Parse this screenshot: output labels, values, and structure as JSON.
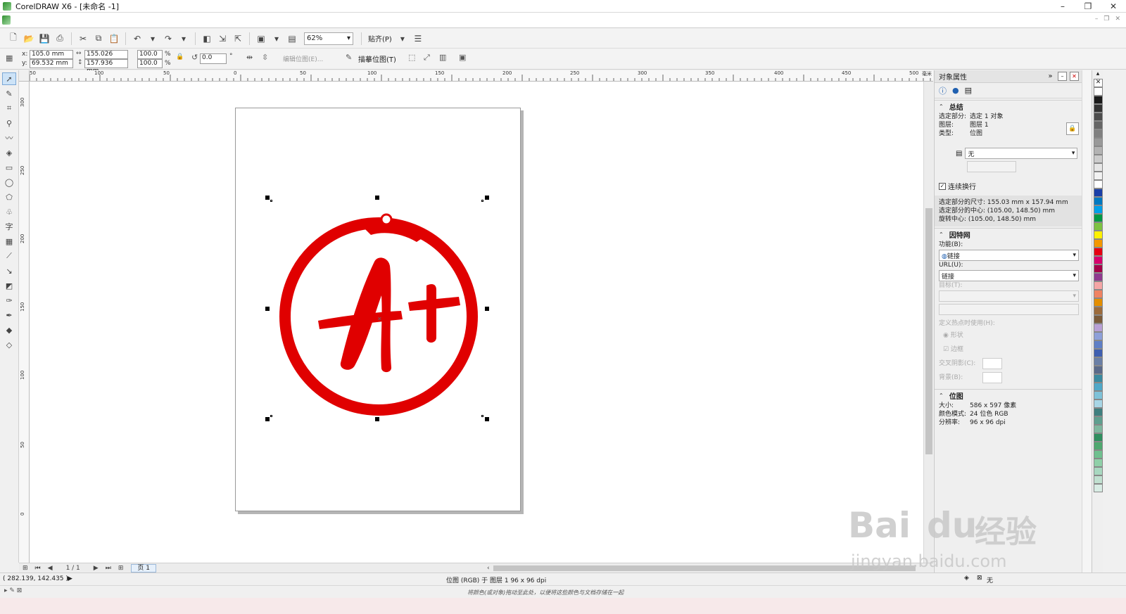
{
  "window": {
    "title": "CorelDRAW X6 - [未命名 -1]",
    "minimize": "–",
    "maximize": "❐",
    "close": "✕"
  },
  "toolbar": {
    "zoom": "62%",
    "snap_label": "贴齐(P)"
  },
  "property_bar": {
    "x_label": "x:",
    "x_value": "105.0 mm",
    "y_label": "y:",
    "y_value": "69.532 mm",
    "width_value": "155.026 mm",
    "height_value": "157.936 mm",
    "scale_w": "100.0",
    "scale_h": "100.0",
    "percent": "%",
    "angle": "0.0",
    "degree": "°",
    "edit_bitmap": "编辑位图(E)...",
    "trace_bitmap": "描摹位图(T)"
  },
  "ruler": {
    "h_ticks": [
      "50",
      "100",
      "50",
      "0",
      "50",
      "100",
      "150",
      "200",
      "250",
      "300",
      "350",
      "400",
      "450",
      "500"
    ],
    "unit": "毫米",
    "v_ticks": [
      "300",
      "250",
      "200",
      "150",
      "100",
      "50",
      "0"
    ]
  },
  "page_nav": {
    "counter": "1 / 1",
    "tab": "页 1"
  },
  "docker": {
    "title": "对象属性",
    "summary": {
      "heading": "总结",
      "rows": [
        {
          "k": "选定部分:",
          "v": "选定 1 对象"
        },
        {
          "k": "图层:",
          "v": "图层 1"
        },
        {
          "k": "类型:",
          "v": "位图"
        }
      ],
      "wrap_select": "无",
      "continuous_wrap": "连续换行",
      "size_info": "选定部分的尺寸: 155.03 mm x 157.94 mm",
      "center_info": "选定部分的中心: (105.00, 148.50) mm",
      "rotate_info": "旋转中心:         (105.00, 148.50) mm"
    },
    "internet": {
      "heading": "因特网",
      "behavior_label": "功能(B):",
      "behavior_value": "链接",
      "url_label": "URL(U):",
      "url_value": "链接",
      "target_label": "目标(T):",
      "hotspot_label": "定义热点时使用(H):",
      "shape_label": "形状",
      "border_label": "边框",
      "cross_label": "交叉阴影(C):",
      "bg_label": "背景(B):"
    },
    "bitmap": {
      "heading": "位图",
      "rows": [
        {
          "k": "大小:",
          "v": "586 x 597 像素"
        },
        {
          "k": "颜色模式:",
          "v": "24 位色 RGB"
        },
        {
          "k": "分辨率:",
          "v": "96 x 96 dpi"
        }
      ]
    }
  },
  "palette": [
    "#ffffff",
    "#1a1a1a",
    "#333333",
    "#4d4d4d",
    "#666666",
    "#808080",
    "#999999",
    "#b3b3b3",
    "#cccccc",
    "#e6e6e6",
    "#f2f2f2",
    "#ffffff",
    "#1a3fa8",
    "#0079c1",
    "#00a0e9",
    "#009944",
    "#7dc242",
    "#fff100",
    "#f39800",
    "#e60012",
    "#d7006c",
    "#a40049",
    "#8f3a8f",
    "#f5a6a6",
    "#f08262",
    "#e48e00",
    "#9c6b3c",
    "#7b5b3a",
    "#b8a0d6",
    "#8ea0d9",
    "#5f7fc6",
    "#3f5fb0",
    "#6a7fa6",
    "#5a6a8a",
    "#3a8aa0",
    "#4fa8c8",
    "#7fc2d8",
    "#a8d6e6",
    "#3f7f7f",
    "#5f9f8f",
    "#7fb89f",
    "#2f8f5f",
    "#4fa86f",
    "#6fc08f",
    "#8fd0a8",
    "#a8d8c0",
    "#c0e0d0",
    "#d8ece4"
  ],
  "status": {
    "coords": "( 282.139, 142.435 )",
    "object_info": "位图 (RGB) 于 图层 1 96 x 96 dpi",
    "fill_label": "无",
    "hint": "将颜色(或对象)拖动至此处，以便将这些颜色与文档存储在一起"
  },
  "watermark": {
    "brand": "Bai",
    "brand2": "du",
    "cn": "经验",
    "url": "jingyan.baidu.com"
  },
  "graphic": {
    "letter": "A+",
    "accent": "#e00000"
  }
}
